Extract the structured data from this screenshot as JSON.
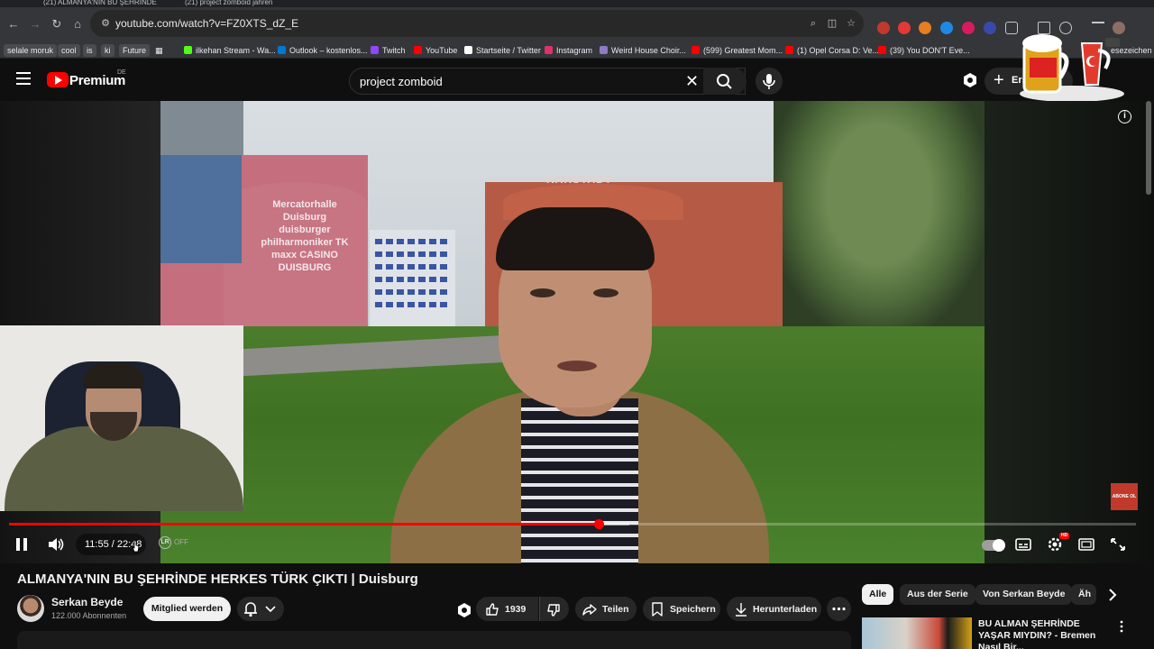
{
  "browser": {
    "tabs": [
      {
        "label": "(21) ALMANYA'NIN BU ŞEHRİNDE"
      },
      {
        "label": "(21) project zomboid jahren"
      }
    ],
    "url": "youtube.com/watch?v=FZ0XTS_dZ_E",
    "bookmarks": [
      {
        "label": "selale moruk",
        "kind": "folder"
      },
      {
        "label": "cool",
        "kind": "folder"
      },
      {
        "label": "is",
        "kind": "folder"
      },
      {
        "label": "ki",
        "kind": "folder"
      },
      {
        "label": "Future",
        "kind": "folder"
      },
      {
        "label": "ilkehan Stream - Wa...",
        "icon": "kick-icon",
        "color": "#53fc18"
      },
      {
        "label": "Outlook – kostenlos...",
        "icon": "outlook-icon",
        "color": "#0078d4"
      },
      {
        "label": "Twitch",
        "icon": "twitch-icon",
        "color": "#9146ff"
      },
      {
        "label": "YouTube",
        "icon": "youtube-icon",
        "color": "#ff0000"
      },
      {
        "label": "Startseite / Twitter",
        "icon": "x-icon",
        "color": "#ffffff"
      },
      {
        "label": "Instagram",
        "icon": "instagram-icon",
        "color": "#e1306c"
      },
      {
        "label": "Weird House Choir...",
        "icon": "audio-icon",
        "color": "#8e7cc3"
      },
      {
        "label": "(599) Greatest Mom...",
        "icon": "youtube-icon",
        "color": "#ff0000"
      },
      {
        "label": "(1) Opel Corsa D: Ve...",
        "icon": "youtube-icon",
        "color": "#ff0000"
      },
      {
        "label": "(39) You DON'T Eve...",
        "icon": "youtube-icon",
        "color": "#ff0000"
      }
    ],
    "bookmarks_overflow": "esezeichen"
  },
  "youtube": {
    "logo_text": "Premium",
    "logo_region": "DE",
    "search_query": "project zomboid",
    "create_label": "Erst"
  },
  "player": {
    "time_current": "11:55",
    "time_separator": " / ",
    "time_total": "22:48",
    "progress_played": 0.523,
    "progress_buffered": 0.55,
    "toggle_off_label": "OFF",
    "sign_text": "Mercatorhalle Duisburg duisburger philharmoniker TK maxx CASINO DUISBURG",
    "store_sign": "KARSTADT",
    "overlay_badge": "ABONE OL"
  },
  "video": {
    "title": "ALMANYA'NIN BU ŞEHRİNDE HERKES TÜRK ÇIKTI | Duisburg",
    "channel": "Serkan Beyde",
    "subscribers": "122.000 Abonnenten",
    "join_label": "Mitglied werden",
    "likes": "1939",
    "share_label": "Teilen",
    "save_label": "Speichern",
    "download_label": "Herunterladen"
  },
  "sidebar": {
    "chips": [
      "Alle",
      "Aus der Serie",
      "Von Serkan Beyde",
      "Äh"
    ],
    "recommendation": {
      "title": "BU ALMAN ŞEHRİNDE YAŞAR MIYDIN? - Bremen Nasıl Bir..."
    }
  },
  "colors": {
    "accent": "#ff0000",
    "background": "#0f0f0f",
    "pill": "#272727"
  }
}
